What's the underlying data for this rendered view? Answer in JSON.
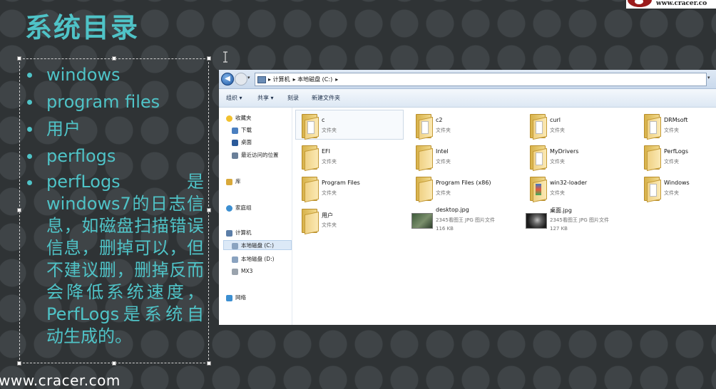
{
  "slide": {
    "title": "系统目录",
    "logo_text": "www.cracer.co",
    "footer_url": "www.cracer.com",
    "accent_color": "#4fc3c7",
    "bullets": [
      "windows",
      "program files",
      "用户",
      "perflogs",
      "perfLogs 是windows7的日志信息，如磁盘扫描错误信息，删掉可以，但不建议删，删掉反而会降低系统速度，PerfLogs是系统自动生成的。"
    ]
  },
  "explorer": {
    "breadcrumbs": [
      "计算机",
      "本地磁盘 (C:)"
    ],
    "toolbar": {
      "organize": "组织 ▾",
      "share": "共享 ▾",
      "burn": "刻录",
      "new_folder": "新建文件夹"
    },
    "nav": {
      "favorites": "收藏夹",
      "downloads": "下载",
      "desktop": "桌面",
      "recent": "最近访问的位置",
      "libraries": "库",
      "homegroup": "家庭组",
      "computer": "计算机",
      "drive_c": "本地磁盘 (C:)",
      "drive_d": "本地磁盘 (D:)",
      "mx3": "MX3",
      "network": "网络"
    },
    "items": [
      {
        "name": "c",
        "type": "文件夹",
        "icon": "folder-icon"
      },
      {
        "name": "c2",
        "type": "文件夹",
        "icon": "folder-icon"
      },
      {
        "name": "curl",
        "type": "文件夹",
        "icon": "folder-icon"
      },
      {
        "name": "DRMsoft",
        "type": "文件夹",
        "icon": "folder-icon"
      },
      {
        "name": "EFI",
        "type": "文件夹",
        "icon": "folder-icon"
      },
      {
        "name": "Intel",
        "type": "文件夹",
        "icon": "folder-icon"
      },
      {
        "name": "MyDrivers",
        "type": "文件夹",
        "icon": "folder-icon"
      },
      {
        "name": "PerfLogs",
        "type": "文件夹",
        "icon": "folder-icon"
      },
      {
        "name": "Program Files",
        "type": "文件夹",
        "icon": "folder-icon"
      },
      {
        "name": "Program Files (x86)",
        "type": "文件夹",
        "icon": "folder-icon"
      },
      {
        "name": "win32-loader",
        "type": "文件夹",
        "icon": "folder-icon"
      },
      {
        "name": "Windows",
        "type": "文件夹",
        "icon": "folder-icon"
      },
      {
        "name": "用户",
        "type": "文件夹",
        "icon": "folder-icon"
      },
      {
        "name": "desktop.jpg",
        "type": "2345看图王 JPG 图片文件",
        "size": "116 KB",
        "icon": "image-thumbnail-icon"
      },
      {
        "name": "桌面.jpg",
        "type": "2345看图王 JPG 图片文件",
        "size": "127 KB",
        "icon": "image-thumbnail-icon"
      }
    ]
  }
}
